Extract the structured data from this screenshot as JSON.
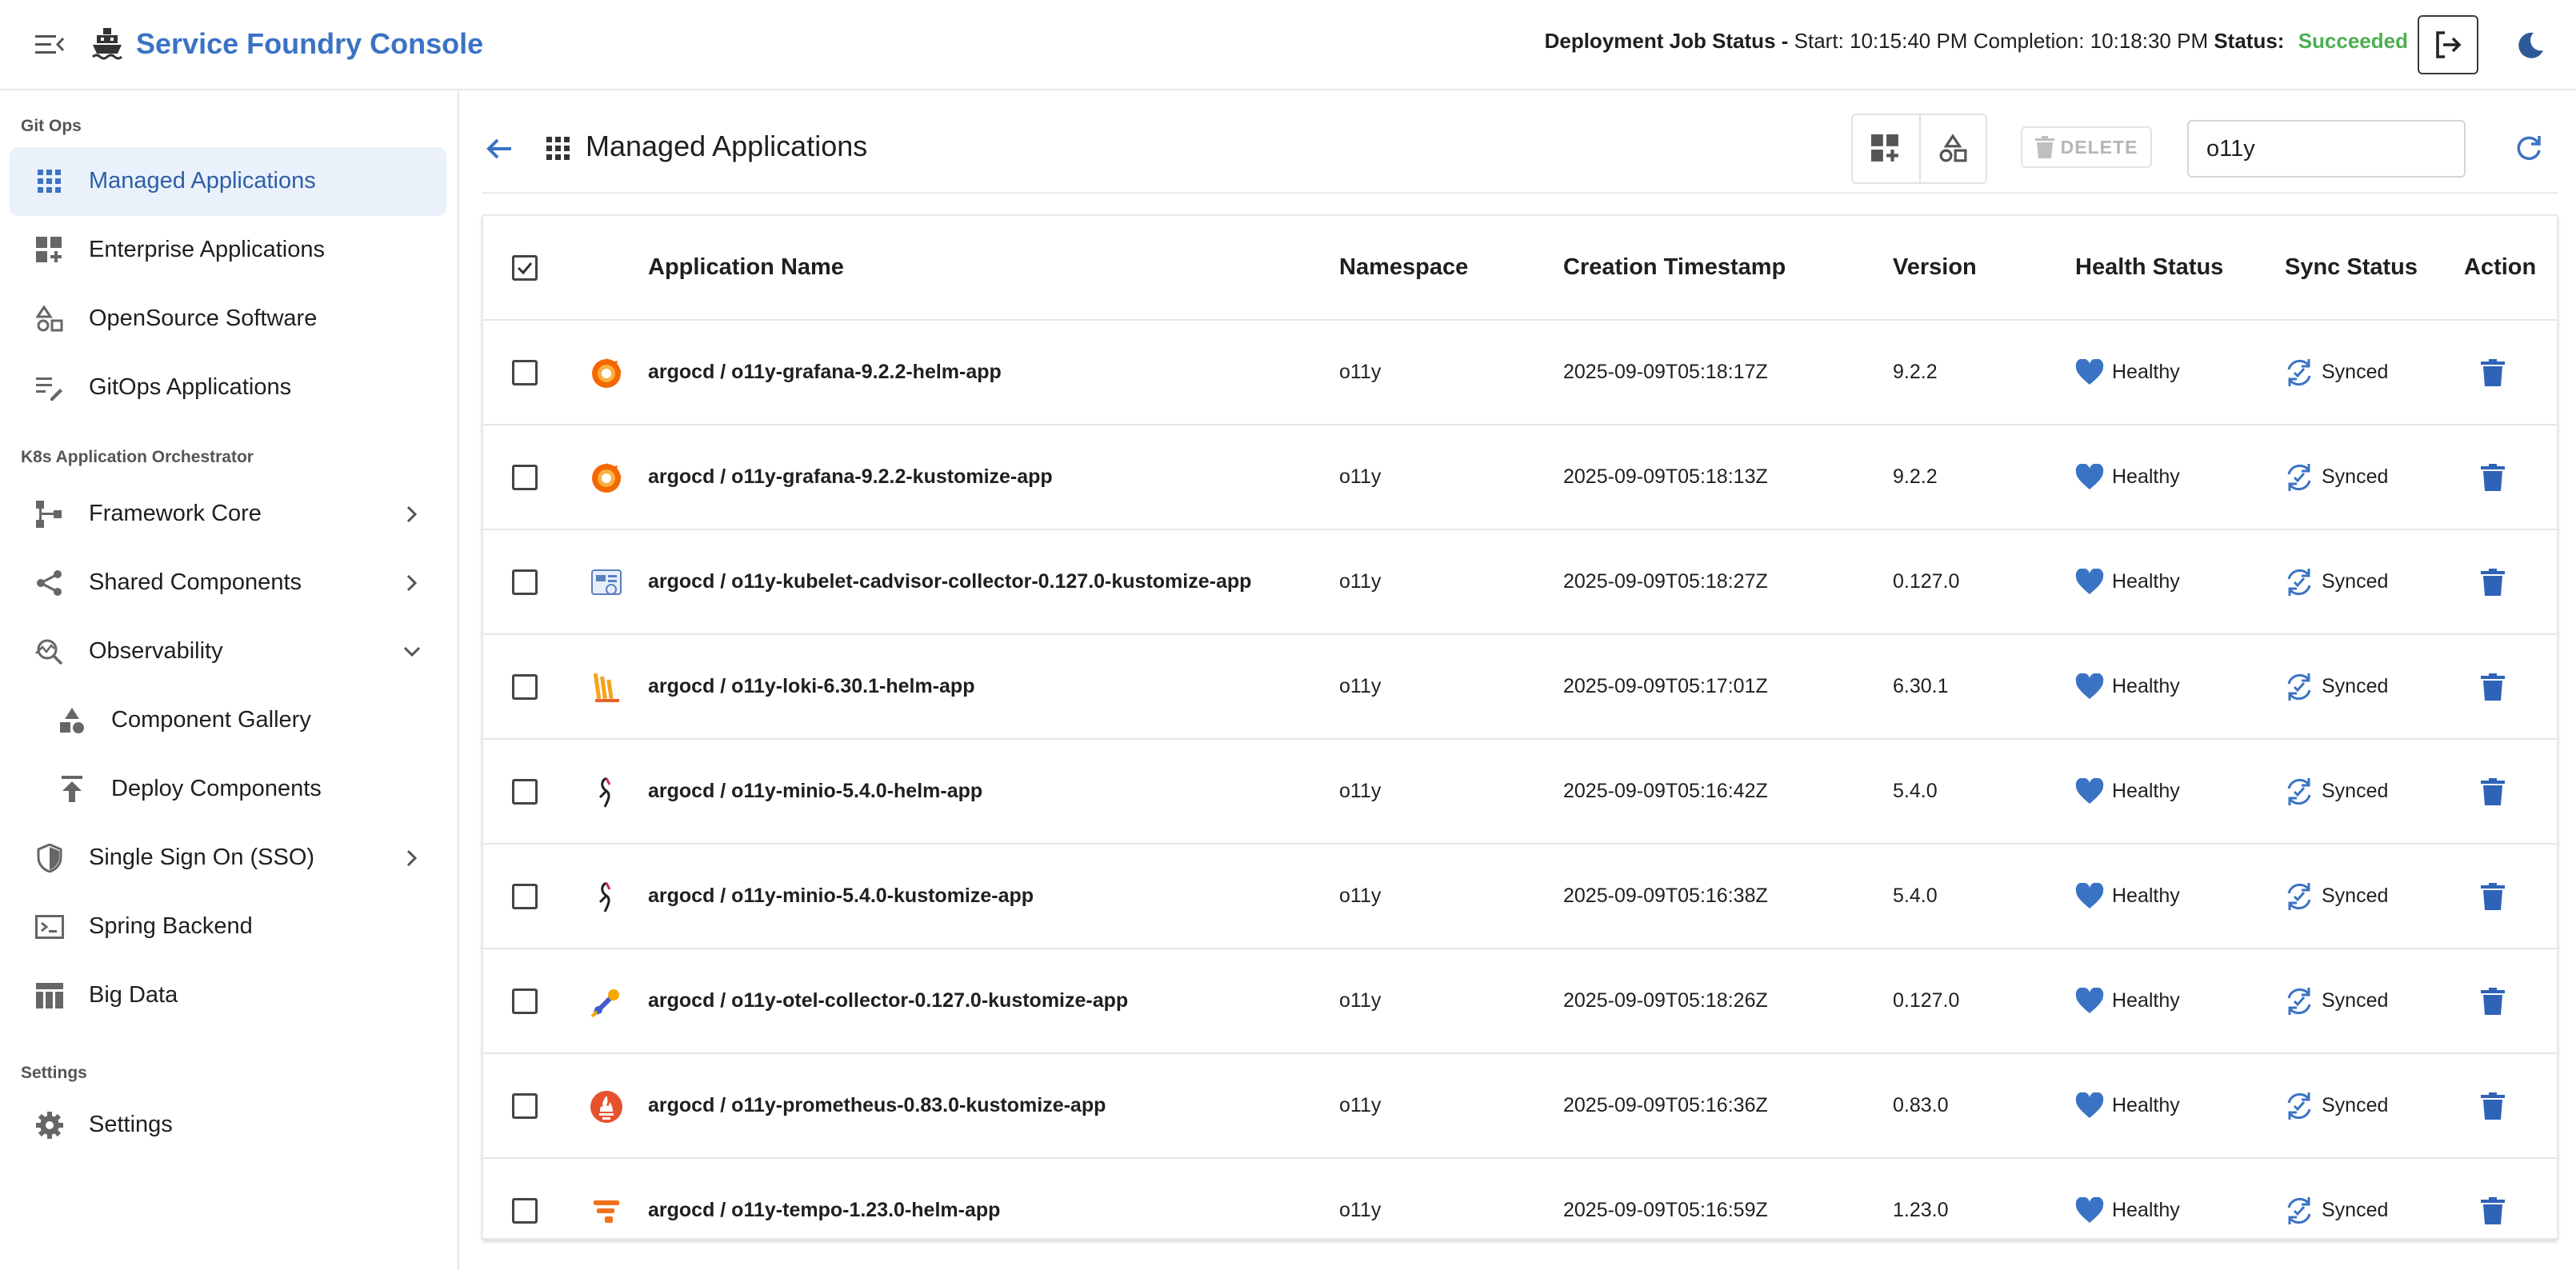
{
  "header": {
    "app_title": "Service Foundry Console",
    "job_status_label": "Deployment Job Status -",
    "start_label": "Start:",
    "start_time": "10:15:40 PM",
    "completion_label": "Completion:",
    "completion_time": "10:18:30 PM",
    "status_label": "Status:",
    "status_value": "Succeeded"
  },
  "sidebar": {
    "sections": [
      {
        "label": "Git Ops"
      },
      {
        "label": "K8s Application Orchestrator"
      },
      {
        "label": "Settings"
      }
    ],
    "items": [
      {
        "label": "Managed Applications",
        "icon": "apps-grid-icon"
      },
      {
        "label": "Enterprise Applications",
        "icon": "dashboard-add-icon"
      },
      {
        "label": "OpenSource Software",
        "icon": "shapes-icon"
      },
      {
        "label": "GitOps Applications",
        "icon": "edit-note-icon"
      },
      {
        "label": "Framework Core",
        "icon": "account-tree-icon"
      },
      {
        "label": "Shared Components",
        "icon": "share-icon"
      },
      {
        "label": "Observability",
        "icon": "query-stats-icon"
      },
      {
        "label": "Component Gallery",
        "icon": "category-icon"
      },
      {
        "label": "Deploy Components",
        "icon": "publish-icon"
      },
      {
        "label": "Single Sign On (SSO)",
        "icon": "shield-icon"
      },
      {
        "label": "Spring Backend",
        "icon": "terminal-icon"
      },
      {
        "label": "Big Data",
        "icon": "table-icon"
      },
      {
        "label": "Settings",
        "icon": "gear-icon"
      }
    ]
  },
  "main": {
    "title": "Managed Applications",
    "delete_label": "DELETE",
    "search_value": "o11y",
    "accent_color": "#3b73c4"
  },
  "table": {
    "columns": [
      "Application Name",
      "Namespace",
      "Creation Timestamp",
      "Version",
      "Health Status",
      "Sync Status",
      "Action"
    ],
    "rows": [
      {
        "name": "argocd / o11y-grafana-9.2.2-helm-app",
        "namespace": "o11y",
        "timestamp": "2025-09-09T05:18:17Z",
        "version": "9.2.2",
        "health": "Healthy",
        "sync": "Synced",
        "icon": "grafana-icon"
      },
      {
        "name": "argocd / o11y-grafana-9.2.2-kustomize-app",
        "namespace": "o11y",
        "timestamp": "2025-09-09T05:18:13Z",
        "version": "9.2.2",
        "health": "Healthy",
        "sync": "Synced",
        "icon": "grafana-icon"
      },
      {
        "name": "argocd / o11y-kubelet-cadvisor-collector-0.127.0-kustomize-app",
        "namespace": "o11y",
        "timestamp": "2025-09-09T05:18:27Z",
        "version": "0.127.0",
        "health": "Healthy",
        "sync": "Synced",
        "icon": "cadvisor-icon"
      },
      {
        "name": "argocd / o11y-loki-6.30.1-helm-app",
        "namespace": "o11y",
        "timestamp": "2025-09-09T05:17:01Z",
        "version": "6.30.1",
        "health": "Healthy",
        "sync": "Synced",
        "icon": "loki-icon"
      },
      {
        "name": "argocd / o11y-minio-5.4.0-helm-app",
        "namespace": "o11y",
        "timestamp": "2025-09-09T05:16:42Z",
        "version": "5.4.0",
        "health": "Healthy",
        "sync": "Synced",
        "icon": "minio-icon"
      },
      {
        "name": "argocd / o11y-minio-5.4.0-kustomize-app",
        "namespace": "o11y",
        "timestamp": "2025-09-09T05:16:38Z",
        "version": "5.4.0",
        "health": "Healthy",
        "sync": "Synced",
        "icon": "minio-icon"
      },
      {
        "name": "argocd / o11y-otel-collector-0.127.0-kustomize-app",
        "namespace": "o11y",
        "timestamp": "2025-09-09T05:18:26Z",
        "version": "0.127.0",
        "health": "Healthy",
        "sync": "Synced",
        "icon": "otel-icon"
      },
      {
        "name": "argocd / o11y-prometheus-0.83.0-kustomize-app",
        "namespace": "o11y",
        "timestamp": "2025-09-09T05:16:36Z",
        "version": "0.83.0",
        "health": "Healthy",
        "sync": "Synced",
        "icon": "prometheus-icon"
      },
      {
        "name": "argocd / o11y-tempo-1.23.0-helm-app",
        "namespace": "o11y",
        "timestamp": "2025-09-09T05:16:59Z",
        "version": "1.23.0",
        "health": "Healthy",
        "sync": "Synced",
        "icon": "tempo-icon"
      }
    ]
  }
}
